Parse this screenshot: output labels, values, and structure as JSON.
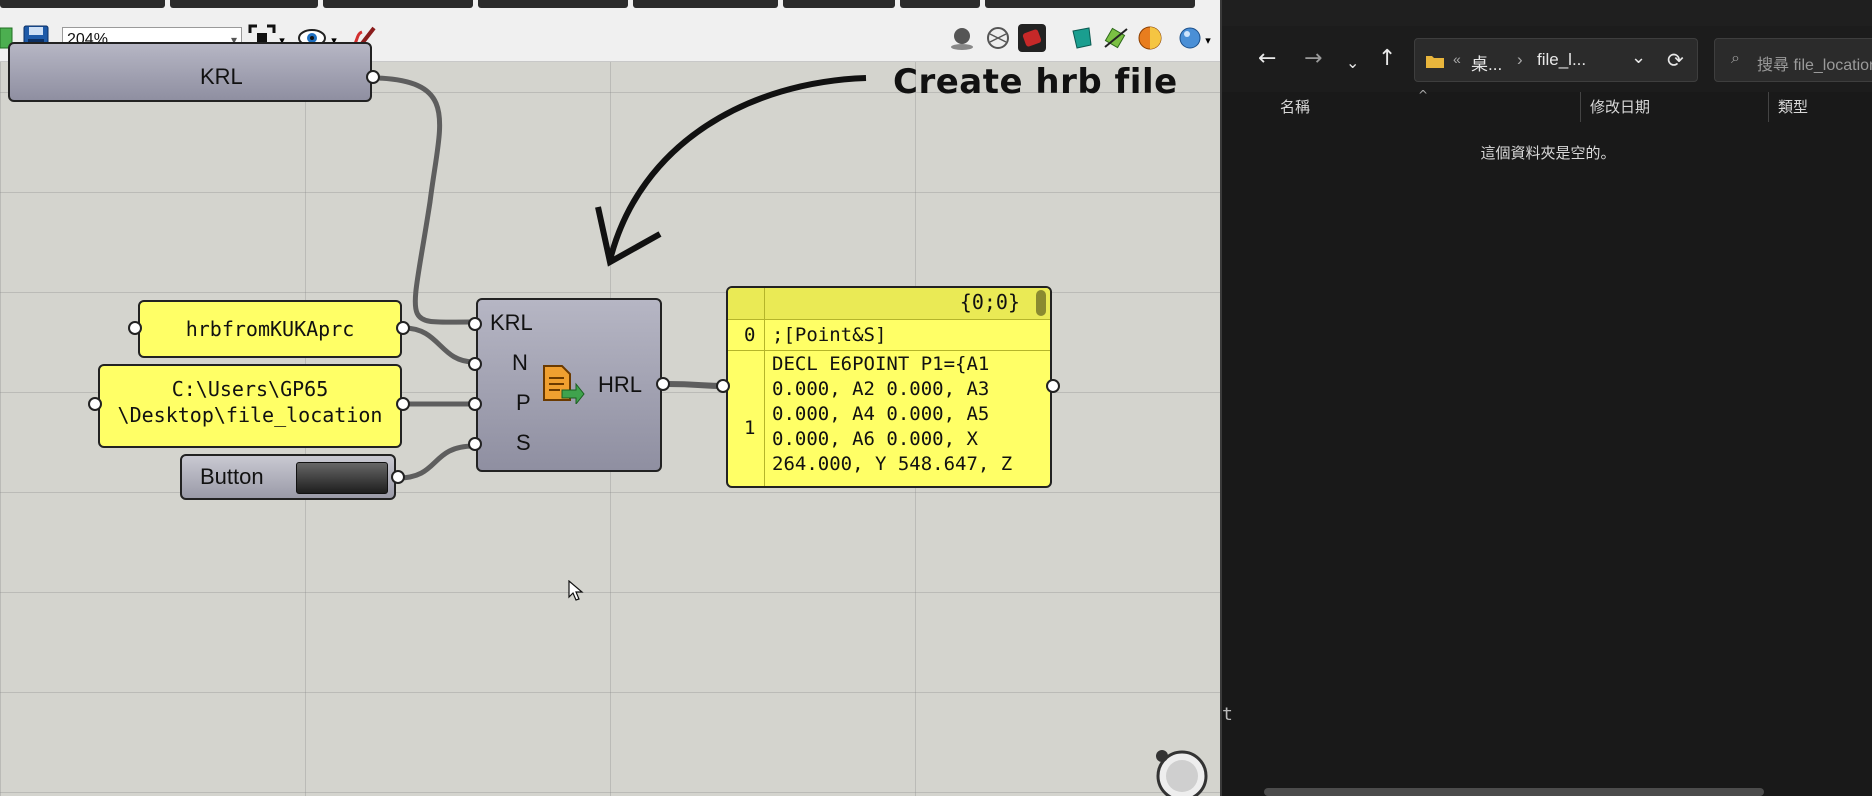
{
  "grasshopper": {
    "zoom": {
      "value": "204%"
    },
    "annotation": "Create hrb file",
    "nodes": {
      "krl_source": {
        "label": "KRL"
      },
      "name_panel": {
        "text": "hrbfromKUKAprc"
      },
      "path_panel": {
        "line1": "C:\\Users\\GP65",
        "line2": "\\Desktop\\file_location"
      },
      "button": {
        "label": "Button"
      },
      "component": {
        "inputs": [
          "KRL",
          "N",
          "P",
          "S"
        ],
        "output": "HRL"
      },
      "output_panel": {
        "path": "{0;0}",
        "rows": [
          {
            "index": "0",
            "lines": [
              ";[Point&S]"
            ]
          },
          {
            "index": "1",
            "lines": [
              "DECL E6POINT P1={A1",
              "0.000, A2 0.000, A3",
              "0.000, A4 0.000, A5",
              "0.000, A6 0.000, X",
              "264.000, Y 548.647, Z"
            ]
          }
        ]
      }
    }
  },
  "explorer": {
    "address": {
      "sep": "«",
      "crumb1": "桌...",
      "arrow": "›",
      "crumb2": "file_l..."
    },
    "search": {
      "placeholder": "搜尋 file_location"
    },
    "columns": {
      "name": "名稱",
      "modified": "修改日期",
      "type": "類型"
    },
    "empty_message": "這個資料夾是空的。"
  },
  "colors": {
    "panel_yellow": "#ffff66",
    "component_gray": "#9e9eb0",
    "explorer_bg": "#191919"
  }
}
